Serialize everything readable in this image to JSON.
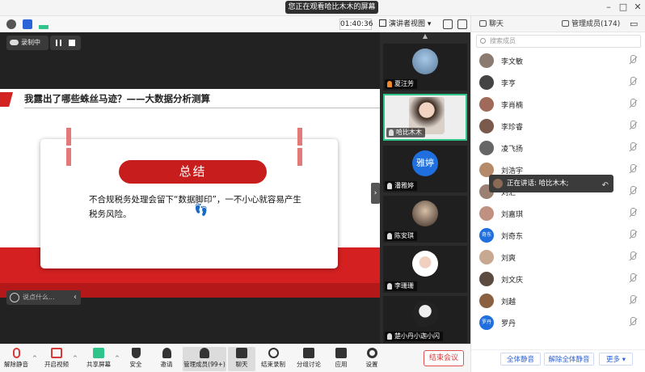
{
  "window": {
    "screen_share_notice": "您正在观看哈比木木的屏幕",
    "notice_dropdown": "▾"
  },
  "toolbar": {
    "timer": "01:40:36",
    "view_mode": "演讲者视图",
    "view_dropdown": "▾"
  },
  "recording": {
    "label": "录制中"
  },
  "slide": {
    "title": "我露出了哪些蛛丝马迹？——大数据分析测算",
    "card_heading": "总结",
    "card_text": "不合规税务处理会留下“数据脚印”，一不小心就容易产生税务风险。",
    "feet": "👣"
  },
  "chat_input": {
    "placeholder": "说点什么...",
    "collapse": "‹"
  },
  "side_collapse": "›",
  "video_tiles": [
    {
      "name": "夏汪芳",
      "orange": true
    },
    {
      "name": "哈比木木",
      "orange": false
    },
    {
      "name": "潘雅婷",
      "orange": false,
      "avatar_text": "雅婷"
    },
    {
      "name": "陈安琪",
      "orange": false
    },
    {
      "name": "李珊珊",
      "orange": false
    },
    {
      "name": "楚小丹小迦小闪",
      "orange": false
    }
  ],
  "video_scroll_up": "▲",
  "right_panel": {
    "tab_chat": "聊天",
    "tab_members": "管理成员(174)",
    "search_placeholder": "搜索成员",
    "members": [
      {
        "name": "李文敏",
        "color": "#8a7a70"
      },
      {
        "name": "李亨",
        "color": "#444444"
      },
      {
        "name": "李肖楠",
        "color": "#a06a5a"
      },
      {
        "name": "李珍睿",
        "color": "#7a5a4a"
      },
      {
        "name": "凌飞扬",
        "color": "#666666"
      },
      {
        "name": "刘浩宇",
        "color": "#b58a6a"
      },
      {
        "name": "刘汇",
        "color": "#9a8070"
      },
      {
        "name": "刘嘉琪",
        "color": "#c09080"
      },
      {
        "name": "刘奇东",
        "color": "#1f6fde",
        "avatar_text": "奇东"
      },
      {
        "name": "刘爽",
        "color": "#c8a890"
      },
      {
        "name": "刘文庆",
        "color": "#5a4a40"
      },
      {
        "name": "刘越",
        "color": "#8a6040"
      },
      {
        "name": "罗丹",
        "color": "#1f6fde",
        "avatar_text": "罗丹"
      }
    ],
    "speaking_text": "正在讲话: 哈比木木;",
    "actions": {
      "mute_all": "全体静音",
      "unmute_all": "解除全体静音",
      "more": "更多 ▾"
    }
  },
  "bottom_toolbar": {
    "unmute": "解除静音",
    "camera": "开启视频",
    "share": "共享屏幕",
    "security": "安全",
    "invite": "邀请",
    "members": "管理成员(99+)",
    "chat": "聊天",
    "stop_record": "结束录制",
    "breakout": "分组讨论",
    "apps": "应用",
    "settings": "设置",
    "end_meeting": "结束会议",
    "caret": "^"
  },
  "colors": {
    "accent_red": "#d42020",
    "speaking_green": "#2ec48a",
    "link_blue": "#2a62d8"
  }
}
